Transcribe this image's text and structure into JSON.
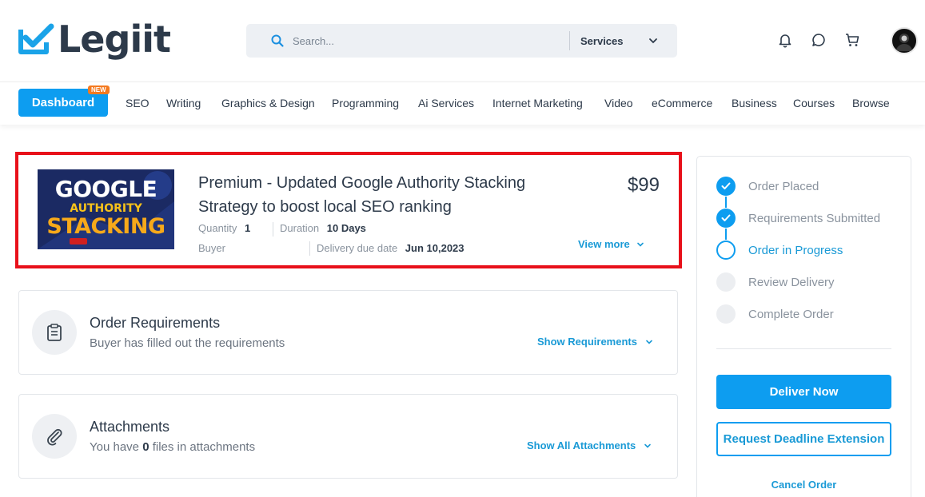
{
  "brand": {
    "name": "Legiit",
    "primary_color": "#0d9df0",
    "highlight_color": "#e8101a"
  },
  "search": {
    "placeholder": "Search...",
    "category": "Services"
  },
  "header_icons": [
    "bell-icon",
    "chat-icon",
    "cart-icon"
  ],
  "nav": {
    "dashboard_label": "Dashboard",
    "badge": "NEW",
    "items": [
      "SEO",
      "Writing",
      "Graphics & Design",
      "Programming",
      "Ai Services",
      "Internet Marketing",
      "Video",
      "eCommerce",
      "Business",
      "Courses",
      "Browse"
    ]
  },
  "order": {
    "thumbnail": {
      "line1": "GOOGLE",
      "line2": "AUTHORITY",
      "line3": "STACKING"
    },
    "title": "Premium - Updated Google Authority Stacking Strategy to boost local SEO ranking",
    "price": "$99",
    "quantity_label": "Quantity",
    "quantity_value": "1",
    "duration_label": "Duration",
    "duration_value": "10 Days",
    "buyer_label": "Buyer",
    "buyer_value": "",
    "due_label": "Delivery due date",
    "due_value": "Jun 10,2023",
    "view_more": "View more"
  },
  "requirements": {
    "title": "Order Requirements",
    "subtitle": "Buyer has filled out the requirements",
    "link": "Show Requirements"
  },
  "attachments": {
    "title": "Attachments",
    "subtitle_pre": "You have",
    "count": "0",
    "subtitle_post": "files in attachments",
    "link": "Show All Attachments"
  },
  "progress": {
    "steps": [
      {
        "label": "Order Placed",
        "state": "done"
      },
      {
        "label": "Requirements Submitted",
        "state": "done"
      },
      {
        "label": "Order in Progress",
        "state": "active"
      },
      {
        "label": "Review Delivery",
        "state": "pending"
      },
      {
        "label": "Complete Order",
        "state": "pending"
      }
    ]
  },
  "actions": {
    "deliver": "Deliver Now",
    "extend": "Request Deadline Extension",
    "cancel": "Cancel Order"
  }
}
